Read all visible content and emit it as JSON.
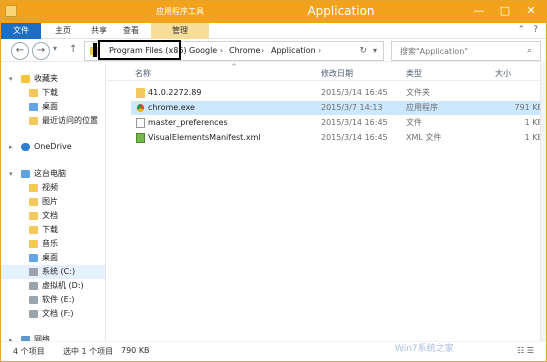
{
  "window": {
    "title": "Application",
    "context_tab": "应用程序工具",
    "controls": {
      "minimize": "—",
      "maximize": "□",
      "close": "✕"
    }
  },
  "ribbon": {
    "tabs": {
      "file": "文件",
      "home": "主页",
      "share": "共享",
      "view": "查看",
      "manage": "管理"
    },
    "right": {
      "help": "?",
      "expand": "⌃"
    }
  },
  "address_bar": {
    "back": "←",
    "forward": "→",
    "dropdown": "▾",
    "up": "↑",
    "segments": [
      "Program Files (x86)",
      "Google",
      "Chrome",
      "Application"
    ],
    "separator": "›",
    "refresh": "↻",
    "drop_icon": "▾"
  },
  "search": {
    "placeholder": "搜索\"Application\"",
    "icon": "⌕"
  },
  "sidebar": {
    "items": [
      {
        "label": "收藏夹",
        "expand": "▾"
      },
      {
        "label": "下载"
      },
      {
        "label": "桌面"
      },
      {
        "label": "最近访问的位置"
      },
      {
        "label": "OneDrive",
        "expand": "▸"
      },
      {
        "label": "这台电脑",
        "expand": "▾"
      },
      {
        "label": "视频"
      },
      {
        "label": "图片"
      },
      {
        "label": "文档"
      },
      {
        "label": "下载"
      },
      {
        "label": "音乐"
      },
      {
        "label": "桌面"
      },
      {
        "label": "系统 (C:)"
      },
      {
        "label": "虚拟机 (D:)"
      },
      {
        "label": "软件 (E:)"
      },
      {
        "label": "文档 (F:)"
      },
      {
        "label": "网络",
        "expand": "▸"
      }
    ]
  },
  "file_list": {
    "headers": {
      "name": "名称",
      "date": "修改日期",
      "type": "类型",
      "size": "大小"
    },
    "sort_icon": "^",
    "rows": [
      {
        "name": "41.0.2272.89",
        "date": "2015/3/14 16:45",
        "type": "文件夹",
        "size": "",
        "icon": "folder-icon"
      },
      {
        "name": "chrome.exe",
        "date": "2015/3/7 14:13",
        "type": "应用程序",
        "size": "791 KB",
        "icon": "chrome-icon"
      },
      {
        "name": "master_preferences",
        "date": "2015/3/14 16:45",
        "type": "文件",
        "size": "1 KB",
        "icon": "file-icon"
      },
      {
        "name": "VisualElementsManifest.xml",
        "date": "2015/3/14 16:45",
        "type": "XML 文件",
        "size": "1 KB",
        "icon": "xml-icon"
      }
    ]
  },
  "status": {
    "count": "4 个项目",
    "selected": "选中 1 个项目",
    "size": "790 KB",
    "view_icons": "☷ ☰"
  },
  "watermark": "Win7系统之家"
}
